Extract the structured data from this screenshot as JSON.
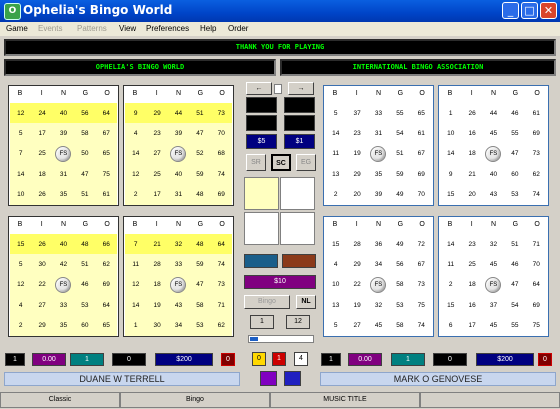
{
  "window": {
    "title": "Ophelia's Bingo World"
  },
  "menu": [
    {
      "label": "Game",
      "enabled": true
    },
    {
      "label": "Events",
      "enabled": false
    },
    {
      "label": "Patterns",
      "enabled": false
    },
    {
      "label": "View",
      "enabled": true
    },
    {
      "label": "Preferences",
      "enabled": true
    },
    {
      "label": "Help",
      "enabled": true
    },
    {
      "label": "Order",
      "enabled": true
    }
  ],
  "marquee": {
    "main": "THANK YOU FOR PLAYING",
    "left": "OPHELIA'S BINGO WORLD",
    "right": "INTERNATIONAL BINGO ASSOCIATION"
  },
  "bingo_letters": [
    "B",
    "I",
    "N",
    "G",
    "O"
  ],
  "free_space": "FS",
  "cards": [
    {
      "color": "yellow",
      "rows": [
        [
          "12",
          "24",
          "40",
          "56",
          "64"
        ],
        [
          "5",
          "17",
          "39",
          "58",
          "67"
        ],
        [
          "7",
          "25",
          "FS",
          "50",
          "65"
        ],
        [
          "14",
          "18",
          "31",
          "47",
          "75"
        ],
        [
          "10",
          "26",
          "35",
          "51",
          "61"
        ]
      ],
      "highlight_row": 0
    },
    {
      "color": "yellow",
      "rows": [
        [
          "9",
          "29",
          "44",
          "51",
          "73"
        ],
        [
          "4",
          "23",
          "39",
          "47",
          "70"
        ],
        [
          "14",
          "27",
          "FS",
          "52",
          "68"
        ],
        [
          "12",
          "25",
          "40",
          "59",
          "74"
        ],
        [
          "2",
          "17",
          "31",
          "48",
          "69"
        ]
      ],
      "highlight_row": 0
    },
    {
      "color": "blue",
      "rows": [
        [
          "5",
          "37",
          "33",
          "55",
          "65"
        ],
        [
          "14",
          "23",
          "31",
          "54",
          "61"
        ],
        [
          "11",
          "19",
          "FS",
          "51",
          "67"
        ],
        [
          "13",
          "29",
          "35",
          "59",
          "69"
        ],
        [
          "2",
          "20",
          "39",
          "49",
          "70"
        ]
      ],
      "highlight_row": -1
    },
    {
      "color": "blue",
      "rows": [
        [
          "1",
          "26",
          "44",
          "46",
          "61"
        ],
        [
          "10",
          "16",
          "45",
          "55",
          "69"
        ],
        [
          "14",
          "18",
          "FS",
          "47",
          "73"
        ],
        [
          "9",
          "21",
          "40",
          "60",
          "62"
        ],
        [
          "15",
          "20",
          "43",
          "53",
          "74"
        ]
      ],
      "highlight_row": -1
    },
    {
      "color": "yellow",
      "rows": [
        [
          "15",
          "26",
          "40",
          "48",
          "66"
        ],
        [
          "5",
          "30",
          "42",
          "51",
          "62"
        ],
        [
          "12",
          "22",
          "FS",
          "46",
          "69"
        ],
        [
          "4",
          "27",
          "33",
          "53",
          "64"
        ],
        [
          "2",
          "29",
          "35",
          "60",
          "65"
        ]
      ],
      "highlight_row": 0
    },
    {
      "color": "yellow",
      "rows": [
        [
          "7",
          "21",
          "32",
          "48",
          "64"
        ],
        [
          "11",
          "28",
          "33",
          "59",
          "74"
        ],
        [
          "12",
          "18",
          "FS",
          "47",
          "73"
        ],
        [
          "14",
          "19",
          "43",
          "58",
          "71"
        ],
        [
          "1",
          "30",
          "34",
          "53",
          "62"
        ]
      ],
      "highlight_row": 0
    },
    {
      "color": "blue",
      "rows": [
        [
          "15",
          "28",
          "36",
          "49",
          "72"
        ],
        [
          "4",
          "29",
          "34",
          "56",
          "67"
        ],
        [
          "10",
          "22",
          "FS",
          "58",
          "73"
        ],
        [
          "13",
          "19",
          "32",
          "53",
          "75"
        ],
        [
          "5",
          "27",
          "45",
          "58",
          "74"
        ]
      ],
      "highlight_row": -1
    },
    {
      "color": "blue",
      "rows": [
        [
          "14",
          "23",
          "32",
          "51",
          "71"
        ],
        [
          "11",
          "25",
          "45",
          "46",
          "70"
        ],
        [
          "2",
          "18",
          "FS",
          "47",
          "64"
        ],
        [
          "15",
          "16",
          "37",
          "54",
          "69"
        ],
        [
          "6",
          "17",
          "45",
          "55",
          "75"
        ]
      ],
      "highlight_row": -1
    }
  ],
  "center": {
    "nav_left": "←",
    "nav_right": "→",
    "bet_left": "$5",
    "bet_right": "$1",
    "btn_sr": "SR",
    "btn_sc": "SC",
    "btn_eg": "EG",
    "jackpot": "$10",
    "bingo_btn": "Bingo",
    "nl_btn": "NL",
    "num_left": "1",
    "num_right": "12",
    "counters": [
      "0",
      "1",
      "4"
    ]
  },
  "players": [
    {
      "name": "DUANE W TERRELL",
      "stats": [
        "1",
        "0.00",
        "1",
        "0",
        "$200",
        "0"
      ]
    },
    {
      "name": "MARK O GENOVESE",
      "stats": [
        "1",
        "0.00",
        "1",
        "0",
        "$200",
        "0"
      ]
    }
  ],
  "statusbar": [
    "Classic",
    "Bingo",
    "MUSIC TITLE"
  ],
  "colors": {
    "accent": "#0044c8",
    "card_yellow": "#ffffc0",
    "card_highlight": "#ffff66",
    "led_text": "#00ff00",
    "bet_blue": "#000080",
    "jackpot": "#800080"
  }
}
